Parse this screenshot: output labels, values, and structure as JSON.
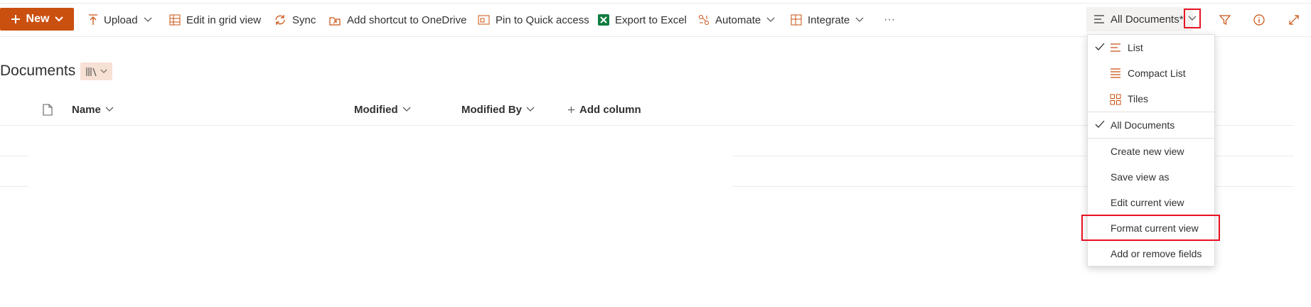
{
  "toolbar": {
    "new_label": "New",
    "upload_label": "Upload",
    "grid_label": "Edit in grid view",
    "sync_label": "Sync",
    "shortcut_label": "Add shortcut to OneDrive",
    "pin_label": "Pin to Quick access",
    "excel_label": "Export to Excel",
    "automate_label": "Automate",
    "integrate_label": "Integrate",
    "more_label": "···",
    "view_label": "All Documents*"
  },
  "page": {
    "title": "Documents"
  },
  "columns": {
    "name": "Name",
    "modified": "Modified",
    "modified_by": "Modified By",
    "add_column": "Add column"
  },
  "view_menu": {
    "list": "List",
    "compact_list": "Compact List",
    "tiles": "Tiles",
    "all_documents": "All Documents",
    "create_new_view": "Create new view",
    "save_view_as": "Save view as",
    "edit_current_view": "Edit current view",
    "format_current_view": "Format current view",
    "add_remove_fields": "Add or remove fields"
  },
  "colors": {
    "accent": "#ca5010",
    "highlight": "#e81123",
    "excel": "#107c41"
  }
}
